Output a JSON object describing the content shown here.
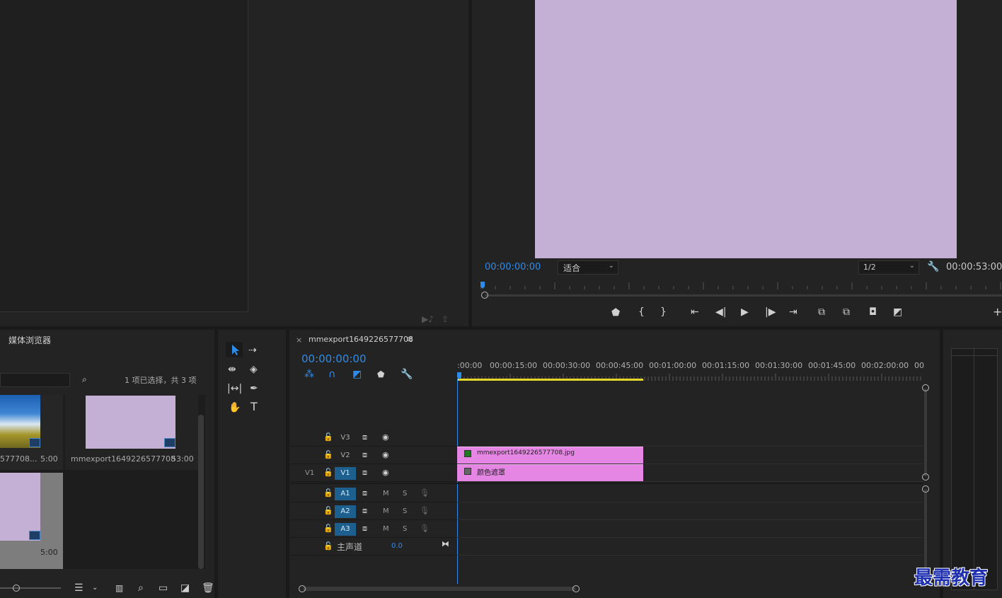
{
  "program_monitor": {
    "timecode_current": "00:00:00:00",
    "fit_label": "适合",
    "resolution_label": "1/2",
    "timecode_duration": "00:00:53:00",
    "frame_color": "#c5b0d5"
  },
  "project_panel": {
    "tab_label": "媒体浏览器",
    "selection_status": "1 项已选择，共 3 项",
    "items": [
      {
        "name": "577708...",
        "duration": "5:00"
      },
      {
        "name": "mmexport1649226577708",
        "duration": "53:00"
      },
      {
        "name": "",
        "duration": "5:00"
      }
    ]
  },
  "timeline": {
    "tab_close": "×",
    "sequence_name": "mmexport1649226577708",
    "menu_icon": "≡",
    "timecode": "00:00:00:00",
    "ruler_labels": [
      ":00:00",
      "00:00:15:00",
      "00:00:30:00",
      "00:00:45:00",
      "00:01:00:00",
      "00:01:15:00",
      "00:01:30:00",
      "00:01:45:00",
      "00:02:00:00",
      "00"
    ],
    "tracks": {
      "v3": "V3",
      "v2": "V2",
      "v1": "V1",
      "v1_source": "V1",
      "a1": "A1",
      "a2": "A2",
      "a3": "A3",
      "mute": "M",
      "solo": "S",
      "master_label": "主声道",
      "master_value": "0.0"
    },
    "clips": {
      "v2_clip": "mmexport1649226577708.jpg",
      "v1_clip": "颜色遮罩"
    },
    "clip_color": "#e586e4"
  },
  "watermark": "最需教育"
}
